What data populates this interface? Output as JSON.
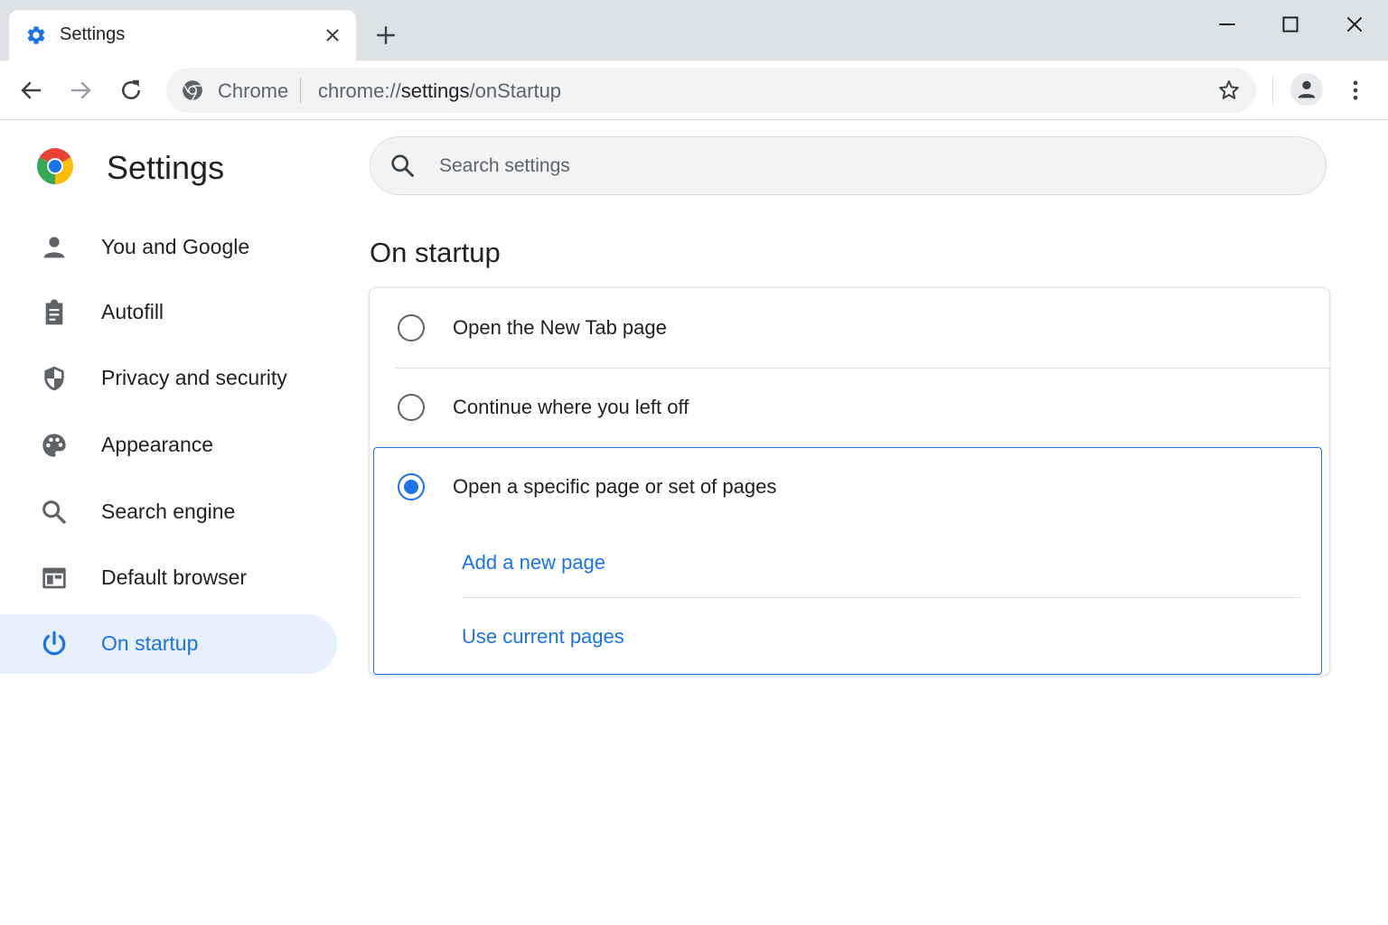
{
  "browser": {
    "tab_title": "Settings",
    "omnibox_chip": "Chrome",
    "url_scheme": "chrome://",
    "url_host": "settings",
    "url_path": "/onStartup"
  },
  "settings": {
    "title": "Settings",
    "search_placeholder": "Search settings",
    "nav": [
      {
        "label": "You and Google",
        "icon": "person-icon",
        "active": false
      },
      {
        "label": "Autofill",
        "icon": "clipboard-icon",
        "active": false
      },
      {
        "label": "Privacy and security",
        "icon": "shield-icon",
        "active": false
      },
      {
        "label": "Appearance",
        "icon": "palette-icon",
        "active": false
      },
      {
        "label": "Search engine",
        "icon": "search-icon",
        "active": false
      },
      {
        "label": "Default browser",
        "icon": "browser-window-icon",
        "active": false
      },
      {
        "label": "On startup",
        "icon": "power-icon",
        "active": true
      }
    ]
  },
  "main": {
    "section_title": "On startup",
    "options": [
      {
        "label": "Open the New Tab page",
        "checked": false
      },
      {
        "label": "Continue where you left off",
        "checked": false
      },
      {
        "label": "Open a specific page or set of pages",
        "checked": true
      }
    ],
    "links": {
      "add_page": "Add a new page",
      "use_current": "Use current pages"
    }
  },
  "colors": {
    "accent": "#1a73e8",
    "active_nav_bg": "#e8f0fe",
    "tab_strip": "#dee1e6",
    "omnibox_bg": "#f1f3f4"
  }
}
